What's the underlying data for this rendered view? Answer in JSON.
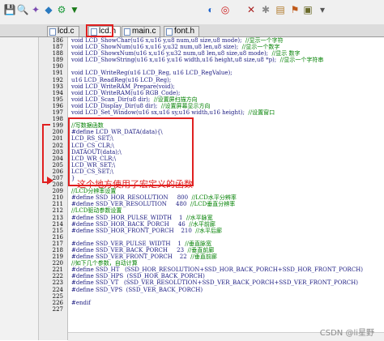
{
  "toolbar": {
    "icons": [
      {
        "name": "save-icon",
        "glyph": "💾",
        "color": "#3a6fb0"
      },
      {
        "name": "find-icon",
        "glyph": "🔍",
        "color": "#333333"
      },
      {
        "name": "wand-icon",
        "glyph": "✦",
        "color": "#7a4ab0"
      },
      {
        "name": "diamond-icon",
        "glyph": "◆",
        "color": "#2a7ac0"
      },
      {
        "name": "build-icon",
        "glyph": "⚙",
        "color": "#1a9a3a"
      },
      {
        "name": "load-icon",
        "glyph": "▼",
        "color": "#1a7a1a"
      },
      {
        "name": "debug-icon",
        "glyph": "◐",
        "color": "#2266cc"
      },
      {
        "name": "target-icon",
        "glyph": "◎",
        "color": "#cc2222"
      },
      {
        "name": "x-icon",
        "glyph": "✕",
        "color": "#aa2222"
      },
      {
        "name": "cog-icon",
        "glyph": "✱",
        "color": "#8a8a8a"
      },
      {
        "name": "stack-icon",
        "glyph": "▤",
        "color": "#b07a2a"
      },
      {
        "name": "flag-icon",
        "glyph": "⚑",
        "color": "#c05a1a"
      },
      {
        "name": "book-icon",
        "glyph": "▣",
        "color": "#6a6a2a"
      },
      {
        "name": "more-icon",
        "glyph": "▾",
        "color": "#555555"
      }
    ]
  },
  "tabs": [
    {
      "label": "lcd.c",
      "active": false
    },
    {
      "label": "lcd.h",
      "active": true
    },
    {
      "label": "main.c",
      "active": false
    },
    {
      "label": "font.h",
      "active": false
    }
  ],
  "code_lines": [
    {
      "n": "186",
      "t": "void LCD_ShowChar(u16 x,u16 y,u8 num,u8 size,u8 mode);",
      "c": "//显示一个字符"
    },
    {
      "n": "187",
      "t": "void LCD_ShowNum(u16 x,u16 y,u32 num,u8 len,u8 size);",
      "c": "//显示一个数字"
    },
    {
      "n": "188",
      "t": "void LCD_ShowxNum(u16 x,u16 y,u32 num,u8 len,u8 size,u8 mode);",
      "c": "//显示 数字"
    },
    {
      "n": "189",
      "t": "void LCD_ShowString(u16 x,u16 y,u16 width,u16 height,u8 size,u8 *p);",
      "c": "//显示一个字符串"
    },
    {
      "n": "190",
      "t": "",
      "c": ""
    },
    {
      "n": "191",
      "t": "void LCD_WriteReg(u16 LCD_Reg, u16 LCD_RegValue);",
      "c": ""
    },
    {
      "n": "192",
      "t": "u16 LCD_ReadReg(u16 LCD_Reg);",
      "c": ""
    },
    {
      "n": "193",
      "t": "void LCD_WriteRAM_Prepare(void);",
      "c": ""
    },
    {
      "n": "194",
      "t": "void LCD_WriteRAM(u16 RGB_Code);",
      "c": ""
    },
    {
      "n": "195",
      "t": "void LCD_Scan_Dir(u8 dir);",
      "c": "//设置屏扫描方向"
    },
    {
      "n": "196",
      "t": "void LCD_Display_Dir(u8 dir);",
      "c": "//设置屏幕显示方向"
    },
    {
      "n": "197",
      "t": "void LCD_Set_Window(u16 sx,u16 sy,u16 width,u16 height);",
      "c": "//设置窗口"
    },
    {
      "n": "198",
      "t": "",
      "c": ""
    },
    {
      "n": "199",
      "t": "",
      "c": "//写数据函数"
    },
    {
      "n": "200",
      "t": "#define LCD_WR_DATA(data){\\",
      "c": ""
    },
    {
      "n": "201",
      "t": "LCD_RS_SET;\\",
      "c": ""
    },
    {
      "n": "202",
      "t": "LCD_CS_CLR;\\",
      "c": ""
    },
    {
      "n": "203",
      "t": "DATAOUT(data);\\",
      "c": ""
    },
    {
      "n": "204",
      "t": "LCD_WR_CLR;\\",
      "c": ""
    },
    {
      "n": "205",
      "t": "LCD_WR_SET;\\",
      "c": ""
    },
    {
      "n": "206",
      "t": "LCD_CS_SET;\\",
      "c": ""
    },
    {
      "n": "207",
      "t": "}",
      "c": ""
    },
    {
      "n": "208",
      "t": "",
      "c": ""
    },
    {
      "n": "209",
      "t": "",
      "c": "//LCD分辨率设置"
    },
    {
      "n": "210",
      "t": "#define SSD_HOR_RESOLUTION     800",
      "c": "//LCD水平分辨率"
    },
    {
      "n": "211",
      "t": "#define SSD_VER_RESOLUTION     480",
      "c": "//LCD垂直分辨率"
    },
    {
      "n": "212",
      "t": "",
      "c": "//LCD驱动参数设置"
    },
    {
      "n": "213",
      "t": "#define SSD_HOR_PULSE_WIDTH    1",
      "c": "//水平脉宽"
    },
    {
      "n": "214",
      "t": "#define SSD_HOR_BACK_PORCH     46",
      "c": "//水平前廊"
    },
    {
      "n": "215",
      "t": "#define SSD_HOR_FRONT_PORCH    210",
      "c": "//水平后廊"
    },
    {
      "n": "216",
      "t": "",
      "c": ""
    },
    {
      "n": "217",
      "t": "#define SSD_VER_PULSE_WIDTH    1",
      "c": "//垂直脉宽"
    },
    {
      "n": "218",
      "t": "#define SSD_VER_BACK_PORCH     23",
      "c": "//垂直前廊"
    },
    {
      "n": "219",
      "t": "#define SSD_VER_FRONT_PORCH    22",
      "c": "//垂直前廊"
    },
    {
      "n": "220",
      "t": "",
      "c": "//如下几个参数，自动计算"
    },
    {
      "n": "221",
      "t": "#define SSD_HT   (SSD_HOR_RESOLUTION+SSD_HOR_BACK_PORCH+SSD_HOR_FRONT_PORCH)",
      "c": ""
    },
    {
      "n": "222",
      "t": "#define SSD_HPS  (SSD_HOR_BACK_PORCH)",
      "c": ""
    },
    {
      "n": "223",
      "t": "#define SSD_VT   (SSD_VER_RESOLUTION+SSD_VER_BACK_PORCH+SSD_VER_FRONT_PORCH)",
      "c": ""
    },
    {
      "n": "224",
      "t": "#define SSD_VPS  (SSD_VER_BACK_PORCH)",
      "c": ""
    },
    {
      "n": "225",
      "t": "",
      "c": ""
    },
    {
      "n": "226",
      "t": "#endif",
      "c": ""
    },
    {
      "n": "227",
      "t": "",
      "c": ""
    }
  ],
  "annotation": "这个地方使用了宏定义的函数",
  "watermark": "CSDN @li星野",
  "colors": {
    "highlight": "#e02020",
    "comment": "#008000",
    "code": "#1a1a80"
  }
}
